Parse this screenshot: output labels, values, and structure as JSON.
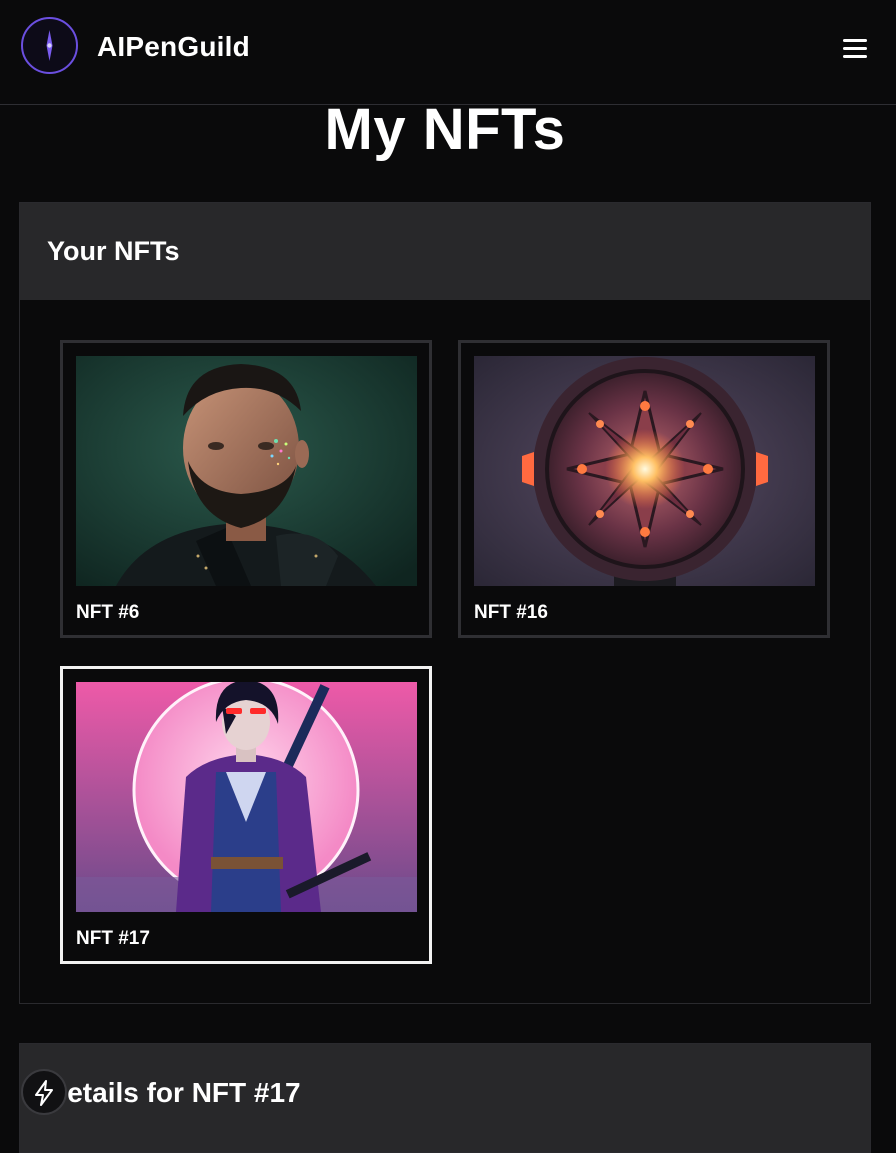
{
  "header": {
    "brand_name": "AIPenGuild",
    "logo_icon": "compass-icon",
    "menu_icon": "hamburger-menu-icon",
    "accent_color": "#6b4fe0"
  },
  "page": {
    "title": "My NFTs"
  },
  "nft_panel": {
    "title": "Your NFTs",
    "items": [
      {
        "label": "NFT #6",
        "image": "bearded man portrait with glitter makeup",
        "selected": false
      },
      {
        "label": "NFT #16",
        "image": "ornate glowing star medallion",
        "selected": false
      },
      {
        "label": "NFT #17",
        "image": "cyber samurai with glowing red visor",
        "selected": true
      }
    ]
  },
  "details_panel": {
    "title": "Details for NFT #17"
  },
  "fab": {
    "icon": "lightning-bolt-icon"
  }
}
